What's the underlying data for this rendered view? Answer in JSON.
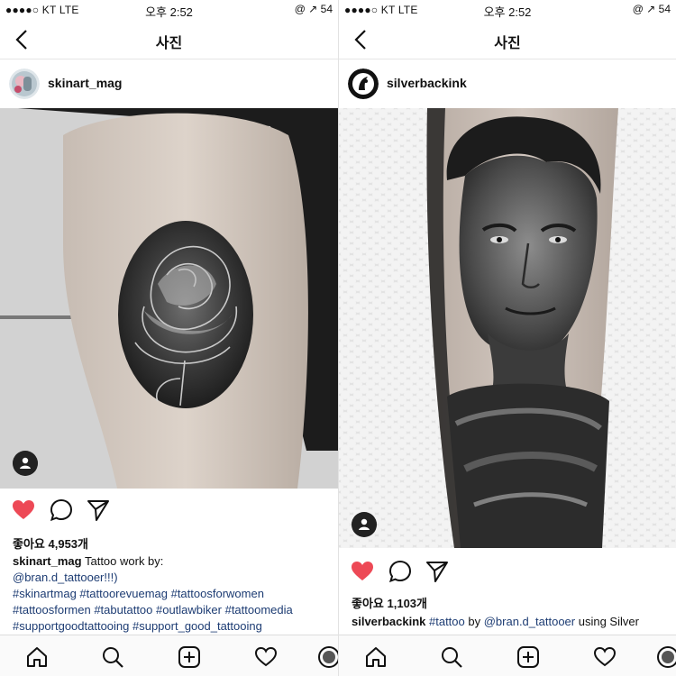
{
  "status_bar": {
    "carrier": "●●●●○ KT  LTE",
    "time": "오후 2:52",
    "right": "@ ↗ 54"
  },
  "nav": {
    "title": "사진"
  },
  "left_post": {
    "username": "skinart_mag",
    "likes": "좋아요 4,953개",
    "caption_user": "skinart_mag",
    "caption_text": " Tattoo work by:",
    "caption_mention": "@bran.d_tattooer!!!)",
    "tag_lines": [
      "#skinartmag #tattoorevuemag #tattoosforwomen",
      "#tattoosformen #tabutattoo #outlawbiker #tattoomedia",
      "#supportgoodtattooing #support_good_tattooing"
    ]
  },
  "right_post": {
    "username": "silverbackink",
    "likes": "좋아요 1,103개",
    "caption_user": "silverbackink",
    "caption_tag": " #tattoo",
    "caption_by": " by ",
    "caption_mention": "@bran.d_tattooer",
    "caption_text": " using Silver"
  },
  "icons": {
    "back": "chevron-left-icon",
    "like": "heart-icon",
    "comment": "comment-icon",
    "share": "send-icon",
    "tag": "person-tag-icon",
    "home": "home-icon",
    "search": "search-icon",
    "add": "add-icon",
    "activity": "heart-outline-icon",
    "profile": "profile-icon"
  },
  "colors": {
    "like_red": "#ed4956",
    "link_blue": "#1d3c73"
  }
}
